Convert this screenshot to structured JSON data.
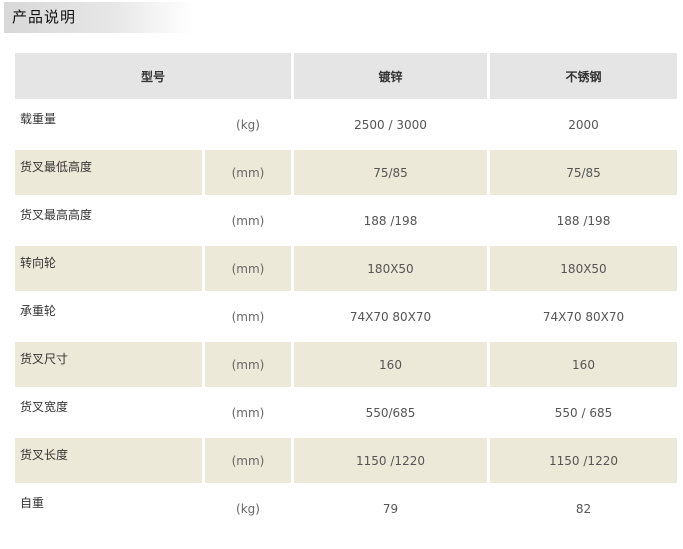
{
  "section_title": "产品说明",
  "header": {
    "model": "型号",
    "galvanized": "镀锌",
    "stainless": "不锈钢"
  },
  "rows": [
    {
      "label": "载重量",
      "unit": "(kg)",
      "galvanized": "2500 / 3000",
      "stainless": "2000"
    },
    {
      "label": "货叉最低高度",
      "unit": "(mm)",
      "galvanized": "75/85",
      "stainless": "75/85"
    },
    {
      "label": "货叉最高高度",
      "unit": "(mm)",
      "galvanized": "188 /198",
      "stainless": "188 /198"
    },
    {
      "label": "转向轮",
      "unit": "(mm)",
      "galvanized": "180X50",
      "stainless": "180X50"
    },
    {
      "label": "承重轮",
      "unit": "(mm)",
      "galvanized": "74X70 80X70",
      "stainless": "74X70 80X70"
    },
    {
      "label": "货叉尺寸",
      "unit": "(mm)",
      "galvanized": "160",
      "stainless": "160"
    },
    {
      "label": "货叉宽度",
      "unit": "(mm)",
      "galvanized": "550/685",
      "stainless": "550 / 685"
    },
    {
      "label": "货叉长度",
      "unit": "(mm)",
      "galvanized": "1150 /1220",
      "stainless": "1150 /1220"
    },
    {
      "label": "自重",
      "unit": "(kg)",
      "galvanized": "79",
      "stainless": "82"
    }
  ]
}
